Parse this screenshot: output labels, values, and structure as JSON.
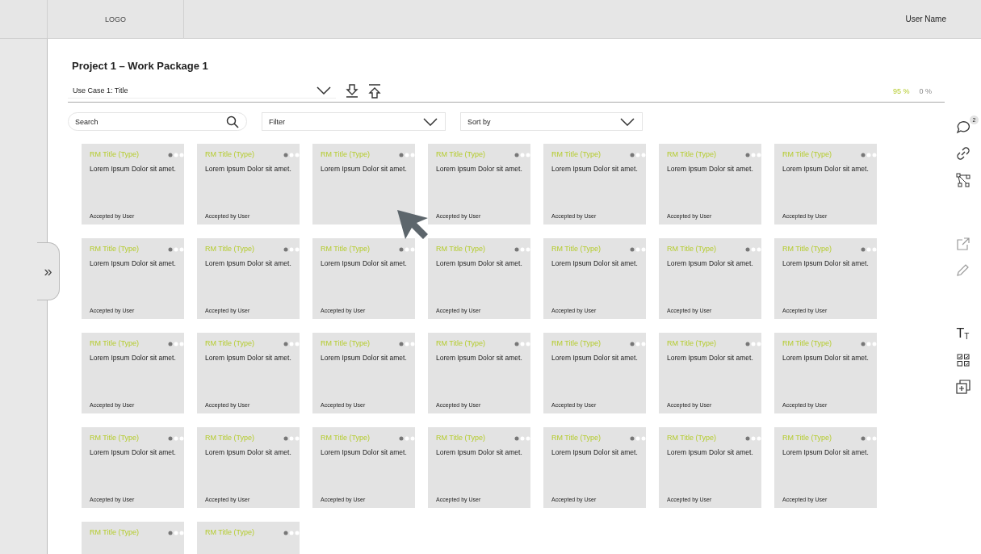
{
  "header": {
    "logo": "LOGO",
    "user_name": "User Name"
  },
  "rail": {
    "toggle": "»"
  },
  "title": "Project 1 – Work Package 1",
  "use_case_select": {
    "value": "Use Case 1: Title"
  },
  "progress": {
    "done": "95 %",
    "open": "0 %"
  },
  "search": {
    "placeholder": "Search"
  },
  "filter": {
    "placeholder": "Filter"
  },
  "sort": {
    "placeholder": "Sort by"
  },
  "toolbar": {
    "comment_badge": "2",
    "text_tool": {
      "large": "T",
      "small": "T"
    }
  },
  "cards": [
    {
      "title": "RM Title (Type)",
      "body": "Lorem Ipsum Dolor sit amet.",
      "footer": "Accepted by User"
    },
    {
      "title": "RM Title (Type)",
      "body": "Lorem Ipsum Dolor sit amet.",
      "footer": "Accepted by User"
    },
    {
      "title": "RM Title (Type)",
      "body": "Lorem Ipsum Dolor sit amet."
    },
    {
      "title": "RM Title (Type)",
      "body": "Lorem Ipsum Dolor sit amet.",
      "footer": "Accepted by User"
    },
    {
      "title": "RM Title (Type)",
      "body": "Lorem Ipsum Dolor sit amet.",
      "footer": "Accepted by User"
    },
    {
      "title": "RM Title (Type)",
      "body": "Lorem Ipsum Dolor sit amet.",
      "footer": "Accepted by User"
    },
    {
      "title": "RM Title (Type)",
      "body": "Lorem Ipsum Dolor sit amet.",
      "footer": "Accepted by User"
    },
    {
      "title": "RM Title (Type)",
      "body": "Lorem Ipsum Dolor sit amet.",
      "footer": "Accepted by User"
    },
    {
      "title": "RM Title (Type)",
      "body": "Lorem Ipsum Dolor sit amet.",
      "footer": "Accepted by User"
    },
    {
      "title": "RM Title (Type)",
      "body": "Lorem Ipsum Dolor sit amet.",
      "footer": "Accepted by User"
    },
    {
      "title": "RM Title (Type)",
      "body": "Lorem Ipsum Dolor sit amet.",
      "footer": "Accepted by User"
    },
    {
      "title": "RM Title (Type)",
      "body": "Lorem Ipsum Dolor sit amet.",
      "footer": "Accepted by User"
    },
    {
      "title": "RM Title (Type)",
      "body": "Lorem Ipsum Dolor sit amet.",
      "footer": "Accepted by User"
    },
    {
      "title": "RM Title (Type)",
      "body": "Lorem Ipsum Dolor sit amet.",
      "footer": "Accepted by User"
    },
    {
      "title": "RM Title (Type)",
      "body": "Lorem Ipsum Dolor sit amet.",
      "footer": "Accepted by User"
    },
    {
      "title": "RM Title (Type)",
      "body": "Lorem Ipsum Dolor sit amet.",
      "footer": "Accepted by User"
    },
    {
      "title": "RM Title (Type)",
      "body": "Lorem Ipsum Dolor sit amet.",
      "footer": "Accepted by User"
    },
    {
      "title": "RM Title (Type)",
      "body": "Lorem Ipsum Dolor sit amet.",
      "footer": "Accepted by User"
    },
    {
      "title": "RM Title (Type)",
      "body": "Lorem Ipsum Dolor sit amet.",
      "footer": "Accepted by User"
    },
    {
      "title": "RM Title (Type)",
      "body": "Lorem Ipsum Dolor sit amet.",
      "footer": "Accepted by User"
    },
    {
      "title": "RM Title (Type)",
      "body": "Lorem Ipsum Dolor sit amet.",
      "footer": "Accepted by User"
    },
    {
      "title": "RM Title (Type)",
      "body": "Lorem Ipsum Dolor sit amet.",
      "footer": "Accepted by User"
    },
    {
      "title": "RM Title (Type)",
      "body": "Lorem Ipsum Dolor sit amet.",
      "footer": "Accepted by User"
    },
    {
      "title": "RM Title (Type)",
      "body": "Lorem Ipsum Dolor sit amet.",
      "footer": "Accepted by User"
    },
    {
      "title": "RM Title (Type)",
      "body": "Lorem Ipsum Dolor sit amet.",
      "footer": "Accepted by User"
    },
    {
      "title": "RM Title (Type)",
      "body": "Lorem Ipsum Dolor sit amet.",
      "footer": "Accepted by User"
    },
    {
      "title": "RM Title (Type)",
      "body": "Lorem Ipsum Dolor sit amet.",
      "footer": "Accepted by User"
    },
    {
      "title": "RM Title (Type)",
      "body": "Lorem Ipsum Dolor sit amet.",
      "footer": "Accepted by User"
    },
    {
      "title": "RM Title (Type)"
    },
    {
      "title": "RM Title (Type)"
    }
  ]
}
